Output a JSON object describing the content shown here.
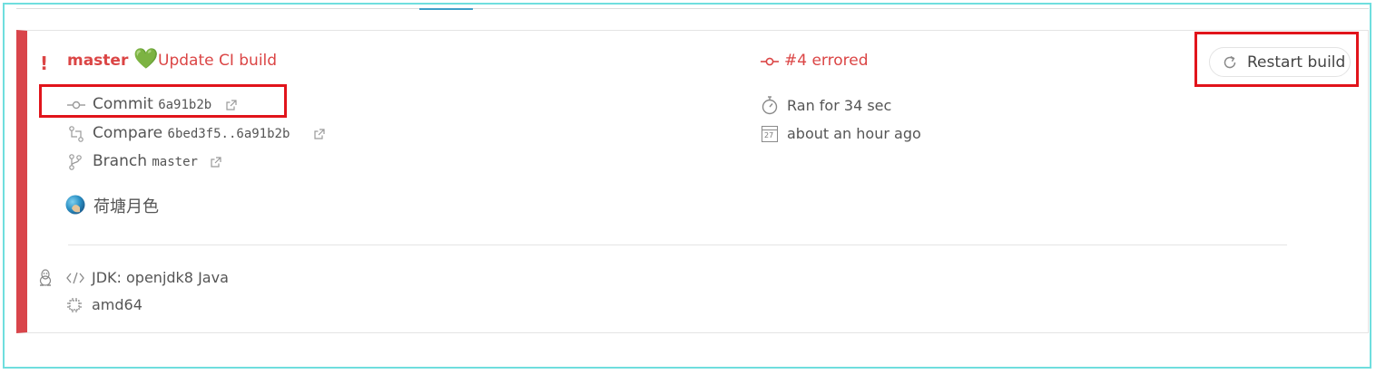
{
  "build": {
    "branch_name": "master",
    "emoji": "💚",
    "message": "Update CI build",
    "status": "#4 errored",
    "commit_label": "Commit",
    "commit_hash": "6a91b2b",
    "compare_label": "Compare",
    "compare_range": "6bed3f5..6a91b2b",
    "branch_label": "Branch",
    "branch_value": "master",
    "author": "荷塘月色",
    "duration": "Ran for 34 sec",
    "finished": "about an hour ago",
    "calendar_day": "27",
    "restart_label": "Restart build",
    "jdk": "JDK: openjdk8 Java",
    "arch": "amd64"
  },
  "colors": {
    "error": "#db4545",
    "accent_tab": "#3ea0c9",
    "highlight_box": "#e1141b",
    "frame": "#6fdede"
  }
}
